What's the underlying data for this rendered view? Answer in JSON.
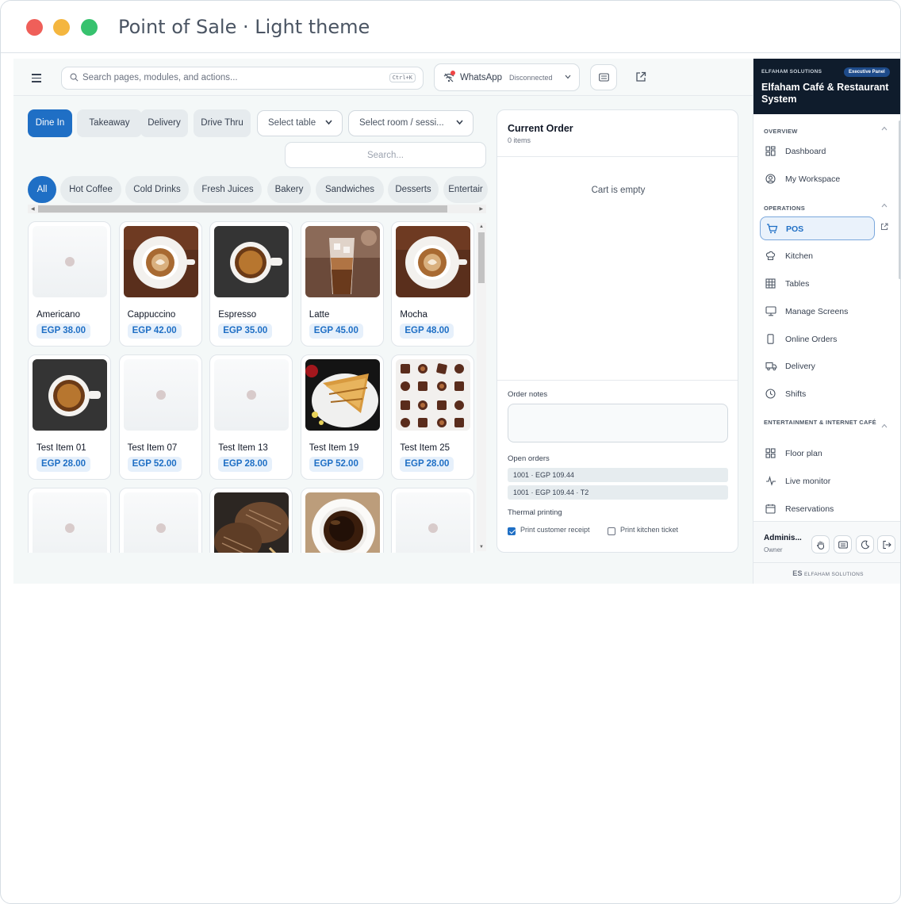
{
  "window": {
    "title": "Point of Sale · Light theme"
  },
  "topbar": {
    "search_placeholder": "Search pages, modules, and actions...",
    "shortcut": "Ctrl+K",
    "whatsapp_label": "WhatsApp",
    "whatsapp_status": "Disconnected"
  },
  "order_types": [
    {
      "label": "Dine In",
      "active": true
    },
    {
      "label": "Takeaway",
      "active": false
    },
    {
      "label": "Delivery",
      "active": false
    },
    {
      "label": "Drive Thru",
      "active": false
    }
  ],
  "selects": {
    "table": "Select table",
    "room": "Select room / sessi..."
  },
  "product_search_placeholder": "Search...",
  "categories": [
    {
      "label": "All",
      "active": true
    },
    {
      "label": "Hot Coffee"
    },
    {
      "label": "Cold Drinks"
    },
    {
      "label": "Fresh Juices"
    },
    {
      "label": "Bakery"
    },
    {
      "label": "Sandwiches"
    },
    {
      "label": "Desserts"
    },
    {
      "label": "Entertair"
    }
  ],
  "products": [
    {
      "name": "Americano",
      "price": "EGP 38.00",
      "image": "placeholder"
    },
    {
      "name": "Cappuccino",
      "price": "EGP 42.00",
      "image": "latte-art"
    },
    {
      "name": "Espresso",
      "price": "EGP 35.00",
      "image": "espresso"
    },
    {
      "name": "Latte",
      "price": "EGP 45.00",
      "image": "iced-latte"
    },
    {
      "name": "Mocha",
      "price": "EGP 48.00",
      "image": "latte-art"
    },
    {
      "name": "Test Item 01",
      "price": "EGP 28.00",
      "image": "espresso"
    },
    {
      "name": "Test Item 07",
      "price": "EGP 52.00",
      "image": "placeholder"
    },
    {
      "name": "Test Item 13",
      "price": "EGP 28.00",
      "image": "placeholder"
    },
    {
      "name": "Test Item 19",
      "price": "EGP 52.00",
      "image": "sandwich"
    },
    {
      "name": "Test Item 25",
      "price": "EGP 28.00",
      "image": "chocolates"
    },
    {
      "name": "",
      "price": "",
      "image": "placeholder"
    },
    {
      "name": "",
      "price": "",
      "image": "placeholder"
    },
    {
      "name": "",
      "price": "",
      "image": "bread"
    },
    {
      "name": "",
      "price": "",
      "image": "black-coffee"
    },
    {
      "name": "",
      "price": "",
      "image": "placeholder"
    }
  ],
  "order": {
    "title": "Current Order",
    "count": "0 items",
    "empty": "Cart is empty",
    "notes_label": "Order notes",
    "open_orders_label": "Open orders",
    "open_orders": [
      "1001 · EGP 109.44",
      "1001 · EGP 109.44 · T2"
    ],
    "thermal_label": "Thermal printing",
    "print_receipt": "Print customer receipt",
    "print_receipt_checked": true,
    "print_kitchen": "Print kitchen ticket",
    "print_kitchen_checked": false
  },
  "sidebar": {
    "company": "ELFAHAM SOLUTIONS",
    "badge": "Executive Panel",
    "app_name": "Elfaham Café & Restaurant System",
    "sections": [
      {
        "title": "OVERVIEW"
      },
      {
        "title": "OPERATIONS"
      },
      {
        "title": "ENTERTAINMENT & INTERNET CAFÉ"
      }
    ],
    "items": [
      {
        "label": "Dashboard",
        "icon": "dashboard-icon"
      },
      {
        "label": "My Workspace",
        "icon": "user-circle-icon"
      },
      {
        "label": "POS",
        "icon": "cart-icon",
        "active": true
      },
      {
        "label": "Kitchen",
        "icon": "chef-hat-icon"
      },
      {
        "label": "Tables",
        "icon": "grid-icon"
      },
      {
        "label": "Manage Screens",
        "icon": "monitor-icon"
      },
      {
        "label": "Online Orders",
        "icon": "phone-icon"
      },
      {
        "label": "Delivery",
        "icon": "truck-icon"
      },
      {
        "label": "Shifts",
        "icon": "clock-icon"
      },
      {
        "label": "Floor plan",
        "icon": "floor-plan-icon"
      },
      {
        "label": "Live monitor",
        "icon": "activity-icon"
      },
      {
        "label": "Reservations",
        "icon": "calendar-icon"
      }
    ],
    "user_name": "Adminis...",
    "user_role": "Owner",
    "footer": "ELFAHAM SOLUTIONS"
  },
  "colors": {
    "accent": "#1f6fc5",
    "brand_dark": "#0f1c2c",
    "danger": "#ef4444"
  }
}
